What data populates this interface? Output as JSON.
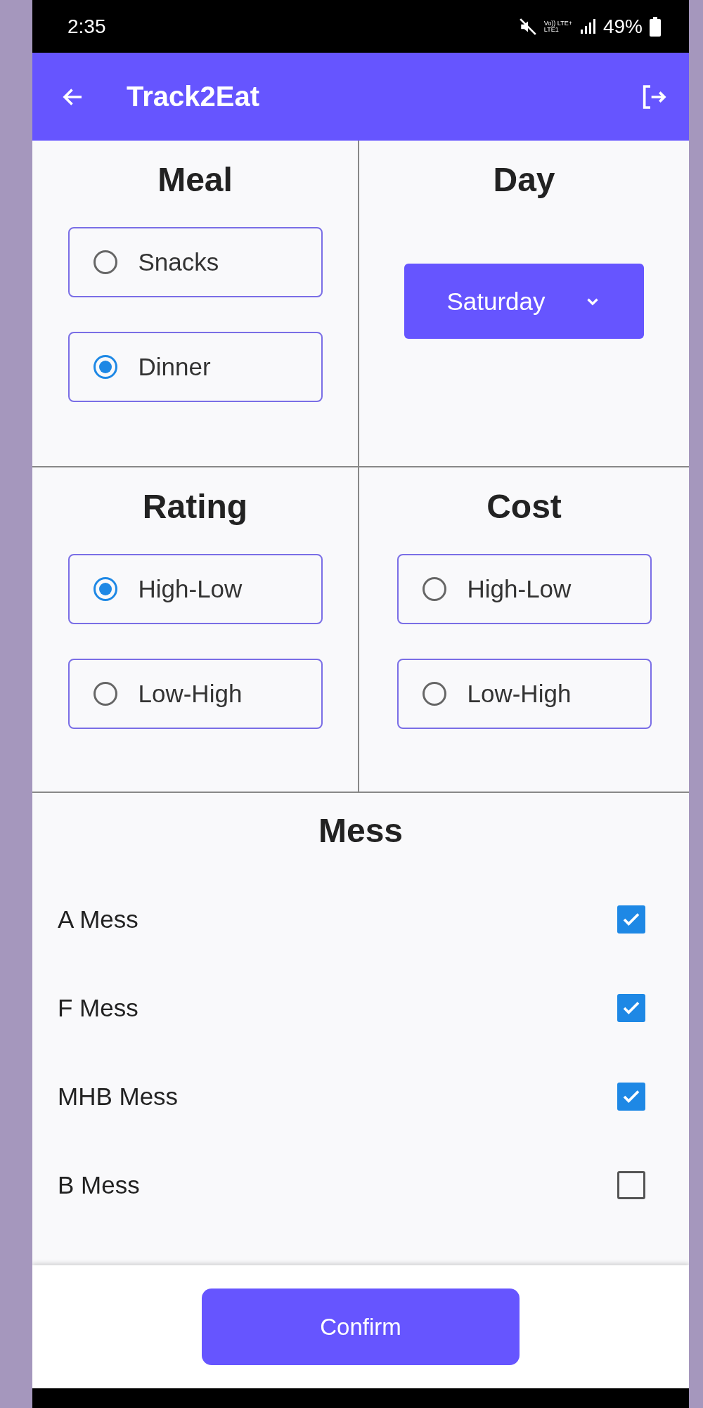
{
  "status_bar": {
    "time": "2:35",
    "network": "Vo)) LTE+\nLTE1",
    "battery": "49%"
  },
  "app_bar": {
    "title": "Track2Eat"
  },
  "meal": {
    "title": "Meal",
    "options": [
      {
        "label": "Snacks",
        "selected": false
      },
      {
        "label": "Dinner",
        "selected": true
      }
    ]
  },
  "day": {
    "title": "Day",
    "value": "Saturday"
  },
  "rating": {
    "title": "Rating",
    "options": [
      {
        "label": "High-Low",
        "selected": true
      },
      {
        "label": "Low-High",
        "selected": false
      }
    ]
  },
  "cost": {
    "title": "Cost",
    "options": [
      {
        "label": "High-Low",
        "selected": false
      },
      {
        "label": "Low-High",
        "selected": false
      }
    ]
  },
  "mess": {
    "title": "Mess",
    "items": [
      {
        "label": "A Mess",
        "checked": true
      },
      {
        "label": "F Mess",
        "checked": true
      },
      {
        "label": "MHB Mess",
        "checked": true
      },
      {
        "label": "B Mess",
        "checked": false
      }
    ]
  },
  "confirm_button": "Confirm"
}
